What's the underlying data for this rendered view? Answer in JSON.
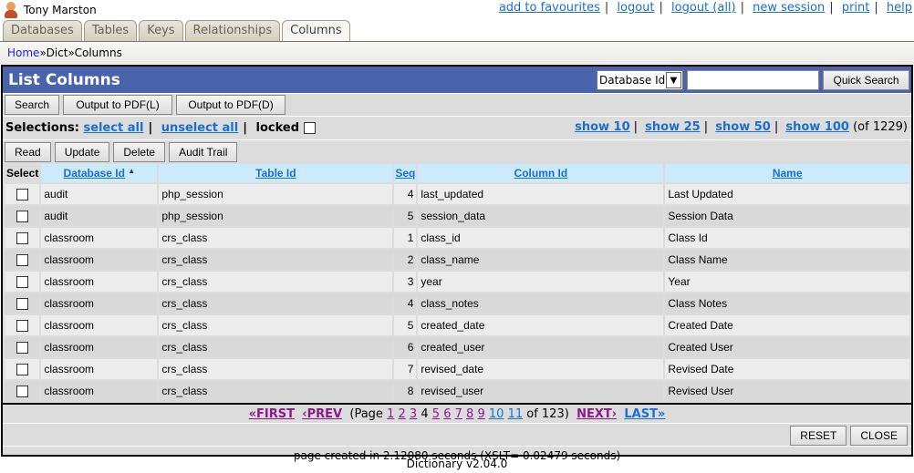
{
  "user": {
    "name": "Tony Marston",
    "icon": "user-icon"
  },
  "toplinks": [
    "add to favourites",
    "logout",
    "logout (all)",
    "new session",
    "print",
    "help"
  ],
  "tabs": [
    {
      "label": "Databases",
      "active": false
    },
    {
      "label": "Tables",
      "active": false
    },
    {
      "label": "Keys",
      "active": false
    },
    {
      "label": "Relationships",
      "active": false
    },
    {
      "label": "Columns",
      "active": true
    }
  ],
  "breadcrumb": {
    "home": "Home",
    "sep": "»",
    "items": [
      "Dict",
      "Columns"
    ]
  },
  "title": "List Columns",
  "quicksearch": {
    "field": "Database Id",
    "value": "",
    "button": "Quick Search"
  },
  "toolbar1": [
    "Search",
    "Output to PDF(L)",
    "Output to PDF(D)"
  ],
  "selections": {
    "label": "Selections:",
    "select_all": "select all",
    "unselect_all": "unselect all",
    "locked": "locked"
  },
  "show": {
    "links": [
      "show 10",
      "show 25",
      "show 50",
      "show 100"
    ],
    "total": "(of 1229)"
  },
  "toolbar2": [
    "Read",
    "Update",
    "Delete",
    "Audit Trail"
  ],
  "table": {
    "headers": {
      "select": "Select",
      "database_id": "Database Id",
      "table_id": "Table Id",
      "seq": "Seq",
      "column_id": "Column Id",
      "name": "Name"
    },
    "sort_indicator": "▲",
    "rows": [
      {
        "database_id": "audit",
        "table_id": "php_session",
        "seq": "4",
        "column_id": "last_updated",
        "name": "Last Updated"
      },
      {
        "database_id": "audit",
        "table_id": "php_session",
        "seq": "5",
        "column_id": "session_data",
        "name": "Session Data"
      },
      {
        "database_id": "classroom",
        "table_id": "crs_class",
        "seq": "1",
        "column_id": "class_id",
        "name": "Class Id"
      },
      {
        "database_id": "classroom",
        "table_id": "crs_class",
        "seq": "2",
        "column_id": "class_name",
        "name": "Class Name"
      },
      {
        "database_id": "classroom",
        "table_id": "crs_class",
        "seq": "3",
        "column_id": "year",
        "name": "Year"
      },
      {
        "database_id": "classroom",
        "table_id": "crs_class",
        "seq": "4",
        "column_id": "class_notes",
        "name": "Class Notes"
      },
      {
        "database_id": "classroom",
        "table_id": "crs_class",
        "seq": "5",
        "column_id": "created_date",
        "name": "Created Date"
      },
      {
        "database_id": "classroom",
        "table_id": "crs_class",
        "seq": "6",
        "column_id": "created_user",
        "name": "Created User"
      },
      {
        "database_id": "classroom",
        "table_id": "crs_class",
        "seq": "7",
        "column_id": "revised_date",
        "name": "Revised Date"
      },
      {
        "database_id": "classroom",
        "table_id": "crs_class",
        "seq": "8",
        "column_id": "revised_user",
        "name": "Revised User"
      }
    ]
  },
  "pager": {
    "first": "«FIRST",
    "prev": "‹PREV",
    "page_label": "(Page",
    "pages": [
      "1",
      "2",
      "3",
      "4",
      "5",
      "6",
      "7",
      "8",
      "9",
      "10",
      "11"
    ],
    "current": "4",
    "of": "of 123)",
    "next": "NEXT›",
    "last": "LAST»"
  },
  "actions": [
    "RESET",
    "CLOSE"
  ],
  "footer": "page created in 2.12080 seconds (XSLT= 0.02479 seconds)",
  "version": "Dictionary v2.04.0"
}
